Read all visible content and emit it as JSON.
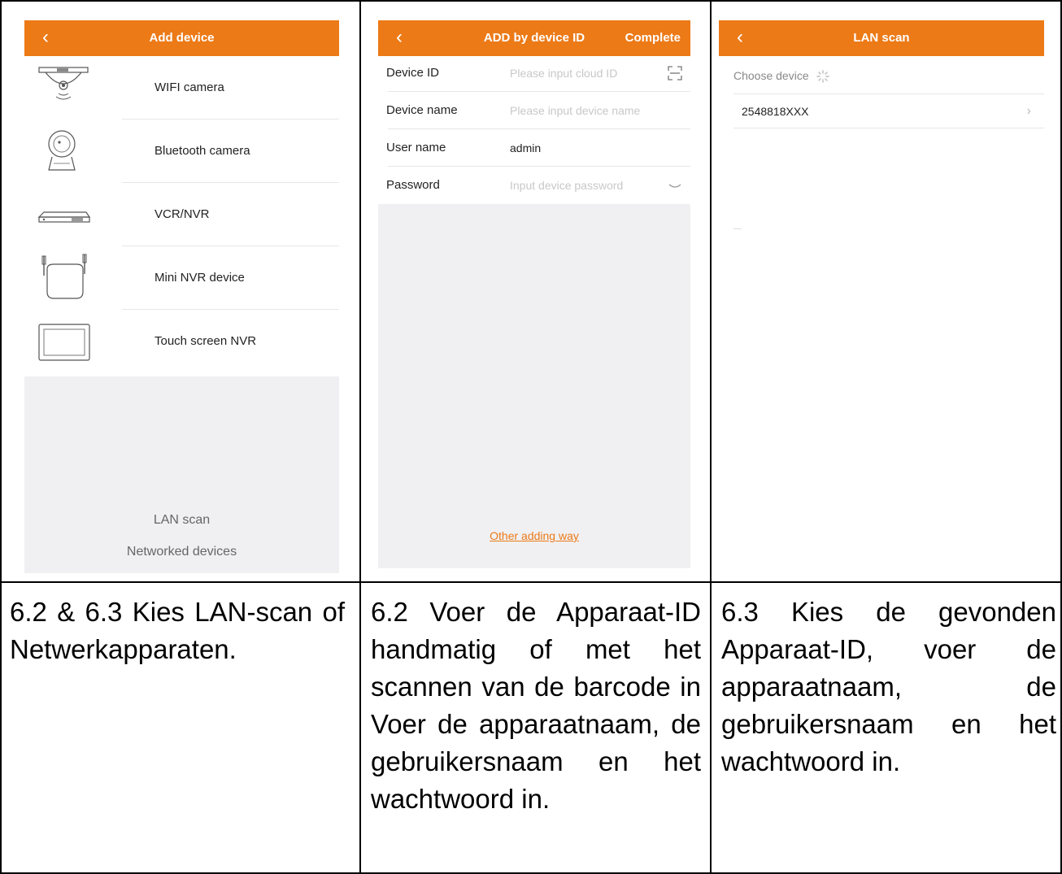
{
  "screen1": {
    "back_icon": "chevron-left-icon",
    "title": "Add device",
    "devices": [
      {
        "label": "WIFI camera",
        "icon": "wifi-camera-icon"
      },
      {
        "label": "Bluetooth camera",
        "icon": "bluetooth-camera-icon"
      },
      {
        "label": "VCR/NVR",
        "icon": "nvr-recorder-icon"
      },
      {
        "label": "Mini NVR device",
        "icon": "mini-nvr-icon"
      },
      {
        "label": "Touch screen NVR",
        "icon": "touch-screen-nvr-icon"
      }
    ],
    "lan_scan": "LAN scan",
    "networked_devices": "Networked devices"
  },
  "screen2": {
    "back_icon": "chevron-left-icon",
    "title": "ADD by device ID",
    "complete": "Complete",
    "fields": [
      {
        "label": "Device ID",
        "placeholder": "Please input cloud ID",
        "icon": "scan-qr-icon"
      },
      {
        "label": "Device name",
        "placeholder": "Please input device name"
      },
      {
        "label": "User name",
        "value": "admin"
      },
      {
        "label": "Password",
        "placeholder": "Input device password",
        "icon": "eye-closed-icon"
      }
    ],
    "other_way": "Other adding way"
  },
  "screen3": {
    "back_icon": "chevron-left-icon",
    "title": "LAN scan",
    "choose_device": "Choose device",
    "found_device": "2548818XXX"
  },
  "captions": {
    "c1": "6.2 & 6.3 Kies LAN-scan of Netwerkapparaten.",
    "c2": "6.2 Voer de Apparaat-ID handmatig of met het scannen van de barcode in Voer de apparaatnaam, de gebruikersnaam en het wachtwoord in.",
    "c3": "6.3 Kies de gevonden Apparaat-ID, voer de apparaatnaam, de gebruikersnaam en het wachtwoord in."
  },
  "colors": {
    "accent": "#ec7a17",
    "panel_gray": "#f0f0f3"
  }
}
